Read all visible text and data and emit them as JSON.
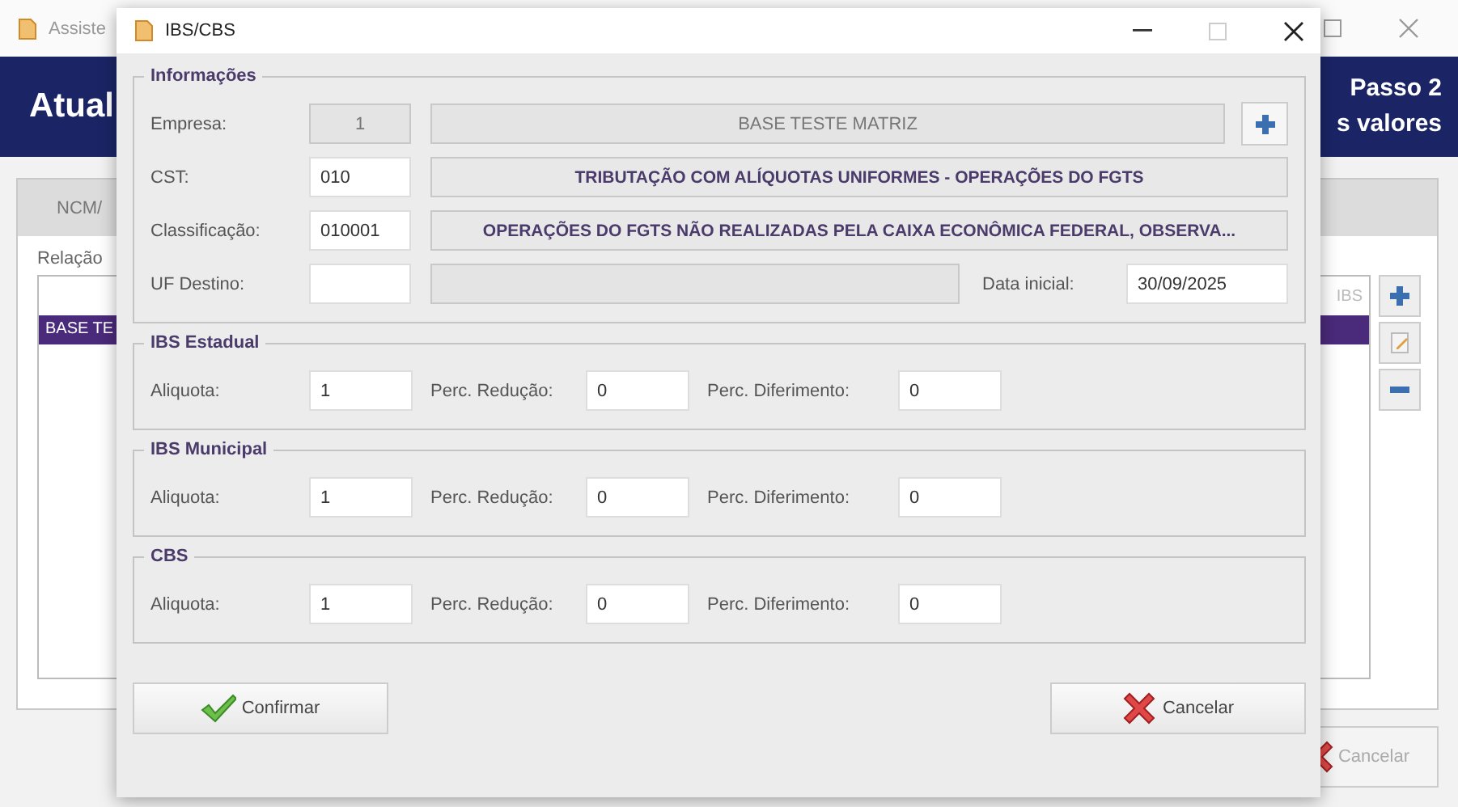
{
  "background_window": {
    "title": "Assiste",
    "header": {
      "title": "Atual",
      "step": "Passo 2",
      "subtitle": "s valores"
    },
    "tab": "NCM/",
    "list": {
      "label": "Relação",
      "column_fragment": "IBS",
      "rows": [
        {
          "text": "BASE TE",
          "selected": true
        }
      ]
    },
    "buttons": [
      {
        "label": "Cancelar",
        "kind": "cancel"
      }
    ]
  },
  "dialog": {
    "title": "IBS/CBS",
    "info": {
      "title": "Informações",
      "rows": [
        {
          "kind": "company",
          "label": "Empresa:",
          "code": "1",
          "description": "BASE TESTE MATRIZ"
        },
        {
          "kind": "code",
          "label": "CST:",
          "code": "010",
          "description": "TRIBUTAÇÃO COM ALÍQUOTAS UNIFORMES - OPERAÇÕES DO FGTS"
        },
        {
          "kind": "code",
          "label": "Classificação:",
          "code": "010001",
          "description": "OPERAÇÕES DO FGTS NÃO REALIZADAS PELA CAIXA ECONÔMICA FEDERAL, OBSERVA..."
        },
        {
          "kind": "date",
          "label": "UF Destino:",
          "date_label": "Data inicial:",
          "date": "30/09/2025"
        }
      ]
    },
    "groups": [
      {
        "title": "IBS Estadual",
        "fields": [
          {
            "label": "Aliquota:",
            "value": "1"
          },
          {
            "label": "Perc. Redução:",
            "value": "0"
          },
          {
            "label": "Perc. Diferimento:",
            "value": "0"
          }
        ]
      },
      {
        "title": "IBS Municipal",
        "fields": [
          {
            "label": "Aliquota:",
            "value": "1"
          },
          {
            "label": "Perc. Redução:",
            "value": "0"
          },
          {
            "label": "Perc. Diferimento:",
            "value": "0"
          }
        ]
      },
      {
        "title": "CBS",
        "fields": [
          {
            "label": "Aliquota:",
            "value": "1"
          },
          {
            "label": "Perc. Redução:",
            "value": "0"
          },
          {
            "label": "Perc. Diferimento:",
            "value": "0"
          }
        ]
      }
    ],
    "buttons": [
      {
        "label": "Confirmar",
        "kind": "confirm"
      },
      {
        "label": "Cancelar",
        "kind": "cancel"
      }
    ]
  }
}
